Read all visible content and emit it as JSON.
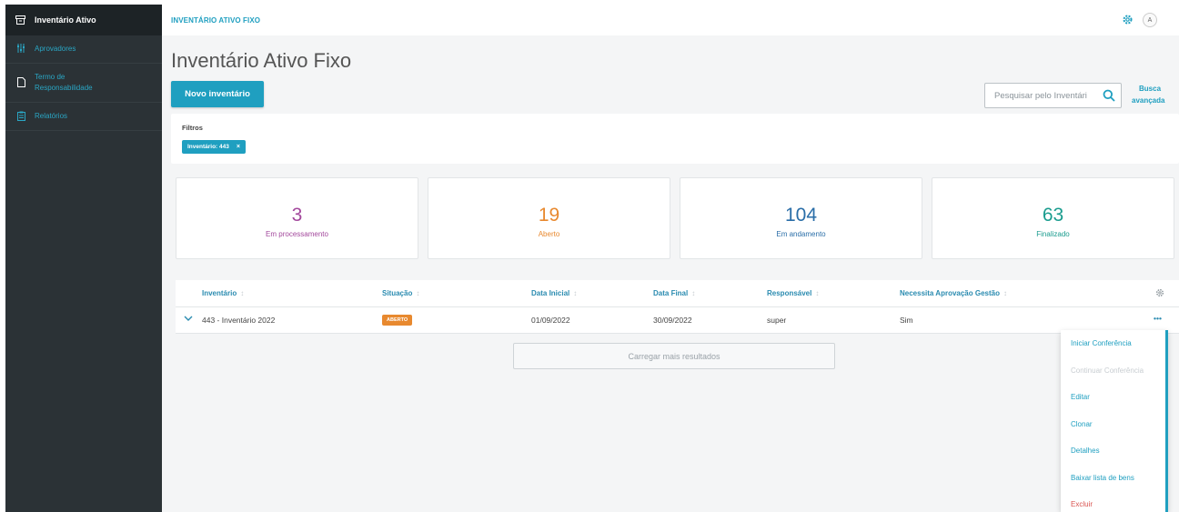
{
  "sidebar": {
    "header": {
      "label": "Inventário Ativo",
      "icon": "archive-icon"
    },
    "items": [
      {
        "label": "Aprovadores",
        "icon": "sliders-icon"
      },
      {
        "label": "Termo de Responsabilidade",
        "line1": "Termo de",
        "line2": "Responsabilidade",
        "icon": "document-icon"
      },
      {
        "label": "Relatórios",
        "icon": "clipboard-icon"
      }
    ]
  },
  "topbar": {
    "breadcrumb": "INVENTÁRIO ATIVO FIXO",
    "avatar": "A"
  },
  "page": {
    "title": "Inventário Ativo Fixo",
    "new_button": "Novo inventário",
    "search_placeholder": "Pesquisar pelo Inventári",
    "advanced_search_line1": "Busca",
    "advanced_search_line2": "avançada"
  },
  "filters": {
    "title": "Filtros",
    "chip": "Inventário: 443",
    "chip_close": "×"
  },
  "cards": [
    {
      "value": "3",
      "label": "Em processamento",
      "color": "#a3489c"
    },
    {
      "value": "19",
      "label": "Aberto",
      "color": "#e8892f"
    },
    {
      "value": "104",
      "label": "Em andamento",
      "color": "#2a6ea8"
    },
    {
      "value": "63",
      "label": "Finalizado",
      "color": "#1a9c8e"
    }
  ],
  "table": {
    "columns": [
      "Inventário",
      "Situação",
      "Data Inicial",
      "Data Final",
      "Responsável",
      "Necessita Aprovação Gestão"
    ],
    "rows": [
      {
        "inventario": "443 - Inventário 2022",
        "situacao": "ABERTO",
        "data_inicial": "01/09/2022",
        "data_final": "30/09/2022",
        "responsavel": "super",
        "aprovacao": "Sim",
        "actions": "•••"
      }
    ],
    "load_more": "Carregar mais resultados"
  },
  "menu": {
    "items": [
      {
        "label": "Iniciar Conferência",
        "state": "normal"
      },
      {
        "label": "Continuar Conferência",
        "state": "disabled"
      },
      {
        "label": "Editar",
        "state": "normal"
      },
      {
        "label": "Clonar",
        "state": "normal"
      },
      {
        "label": "Detalhes",
        "state": "normal"
      },
      {
        "label": "Baixar lista de bens",
        "state": "normal"
      },
      {
        "label": "Excluir",
        "state": "danger"
      }
    ]
  },
  "colors": {
    "accent": "#1f9fc0",
    "sidebar": "#2b3236",
    "badge": "#e8892f",
    "danger": "#d9534f"
  }
}
